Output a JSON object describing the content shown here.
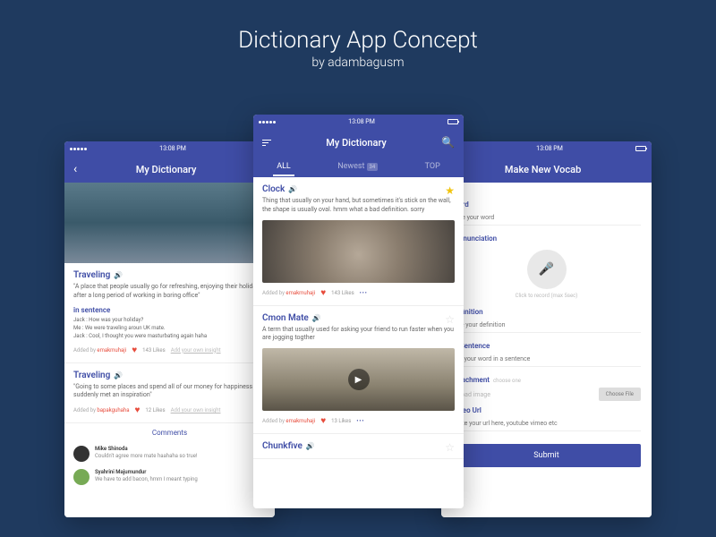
{
  "header": {
    "title": "Dictionary App Concept",
    "subtitle": "by adambagusm"
  },
  "status": {
    "time": "13:08 PM"
  },
  "screen1": {
    "title": "My Dictionary",
    "entry1": {
      "word": "Traveling",
      "def": "\"A place that people usually go for refreshing, enjoying their holiday after a long period of working in boring office\"",
      "sentence_label": "in sentence",
      "d1": "Jack : How was your holiday?",
      "d2": "Me   : We were traveling aroun UK mate.",
      "d3": "Jack : Cool, I thought you were masturbating again haha",
      "addedby_prefix": "Added by ",
      "addedby_user": "emakmuhaji",
      "likes": "143 Likes",
      "insight": "Add your own insight"
    },
    "entry2": {
      "word": "Traveling",
      "def": "\"Going to some places and spend all of our money for happiness and suddenly met an inspiration\"",
      "addedby_prefix": "Added by ",
      "addedby_user": "bapakguhaha",
      "likes": "12 Likes",
      "insight": "Add your own insight"
    },
    "comments_label": "Comments",
    "c1": {
      "name": "Mike Shinoda",
      "text": "Couldn't agree more mate haahaha so true!"
    },
    "c2": {
      "name": "Syahrini Majumundur",
      "text": "We have to add bacon, hmm I meant typing"
    }
  },
  "screen2": {
    "title": "My Dictionary",
    "tabs": {
      "all": "ALL",
      "newest": "Newest",
      "newest_badge": "34",
      "top": "TOP"
    },
    "e1": {
      "word": "Clock",
      "def": "Thing that usually on your hand, but sometimes it's stick on the wall, the shape is usually oval. hmm what a bad definition. sorry",
      "addedby_prefix": "Added by ",
      "addedby_user": "emakmuhaji",
      "likes": "143 Likes"
    },
    "e2": {
      "word": "Cmon Mate",
      "def": "A term that usually used for asking your friend to run faster when you are jogging togther",
      "addedby_prefix": "Added by ",
      "addedby_user": "emakmuhaji",
      "likes": "13 Likes"
    },
    "e3": {
      "word": "Chunkfive"
    }
  },
  "screen3": {
    "title": "Make New Vocab",
    "word_label": "Word",
    "word_ph": "Type your word",
    "pron_label": "Pronunciation",
    "record_hint": "Click to record (max 5sec)",
    "def_label": "Definition",
    "def_ph": "Give your definition",
    "sent_label": "In Sentence",
    "sent_ph": "Use your word in a sentence",
    "attach_label": "Attachment",
    "attach_hint": "choose one",
    "upload_label": "Upload image",
    "choose_file": "Choose File",
    "video_label": "Video Url",
    "video_ph": "paste your url here, youtube vimeo etc",
    "submit": "Submit"
  }
}
